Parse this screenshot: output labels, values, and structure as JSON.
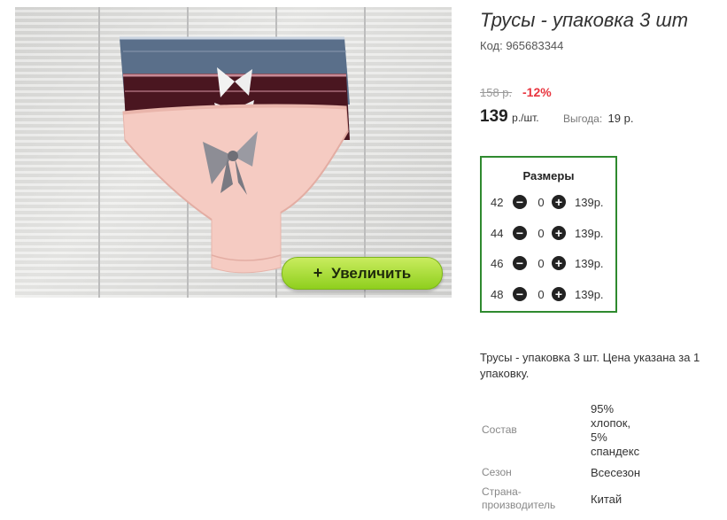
{
  "product": {
    "title": "Трусы - упаковка 3 шт",
    "code": "Код: 965683344",
    "zoom_label": "Увеличить",
    "zoom_icon": "+"
  },
  "pricing": {
    "old_price": "158 р.",
    "discount": "-12%",
    "price": "139",
    "price_unit": "р./шт.",
    "benefit_label": "Выгода:",
    "benefit_value": "19 р."
  },
  "sizes": {
    "title": "Размеры",
    "rows": [
      {
        "size": "42",
        "qty": "0",
        "price": "139р."
      },
      {
        "size": "44",
        "qty": "0",
        "price": "139р."
      },
      {
        "size": "46",
        "qty": "0",
        "price": "139р."
      },
      {
        "size": "48",
        "qty": "0",
        "price": "139р."
      }
    ]
  },
  "description": "Трусы - упаковка 3 шт. Цена указана за 1 упаковку.",
  "specs": [
    {
      "label": "Состав",
      "value": "95% хлопок, 5% спандекс"
    },
    {
      "label": "Сезон",
      "value": "Всесезон"
    },
    {
      "label": "Страна-производитель",
      "value": "Китай"
    }
  ],
  "colors": {
    "border_green": "#2f8a2f",
    "zoom_button": "#a8dc3a",
    "discount_red": "#e8353f"
  },
  "icons": {
    "minus": "minus-circle-icon",
    "plus": "plus-circle-icon"
  }
}
